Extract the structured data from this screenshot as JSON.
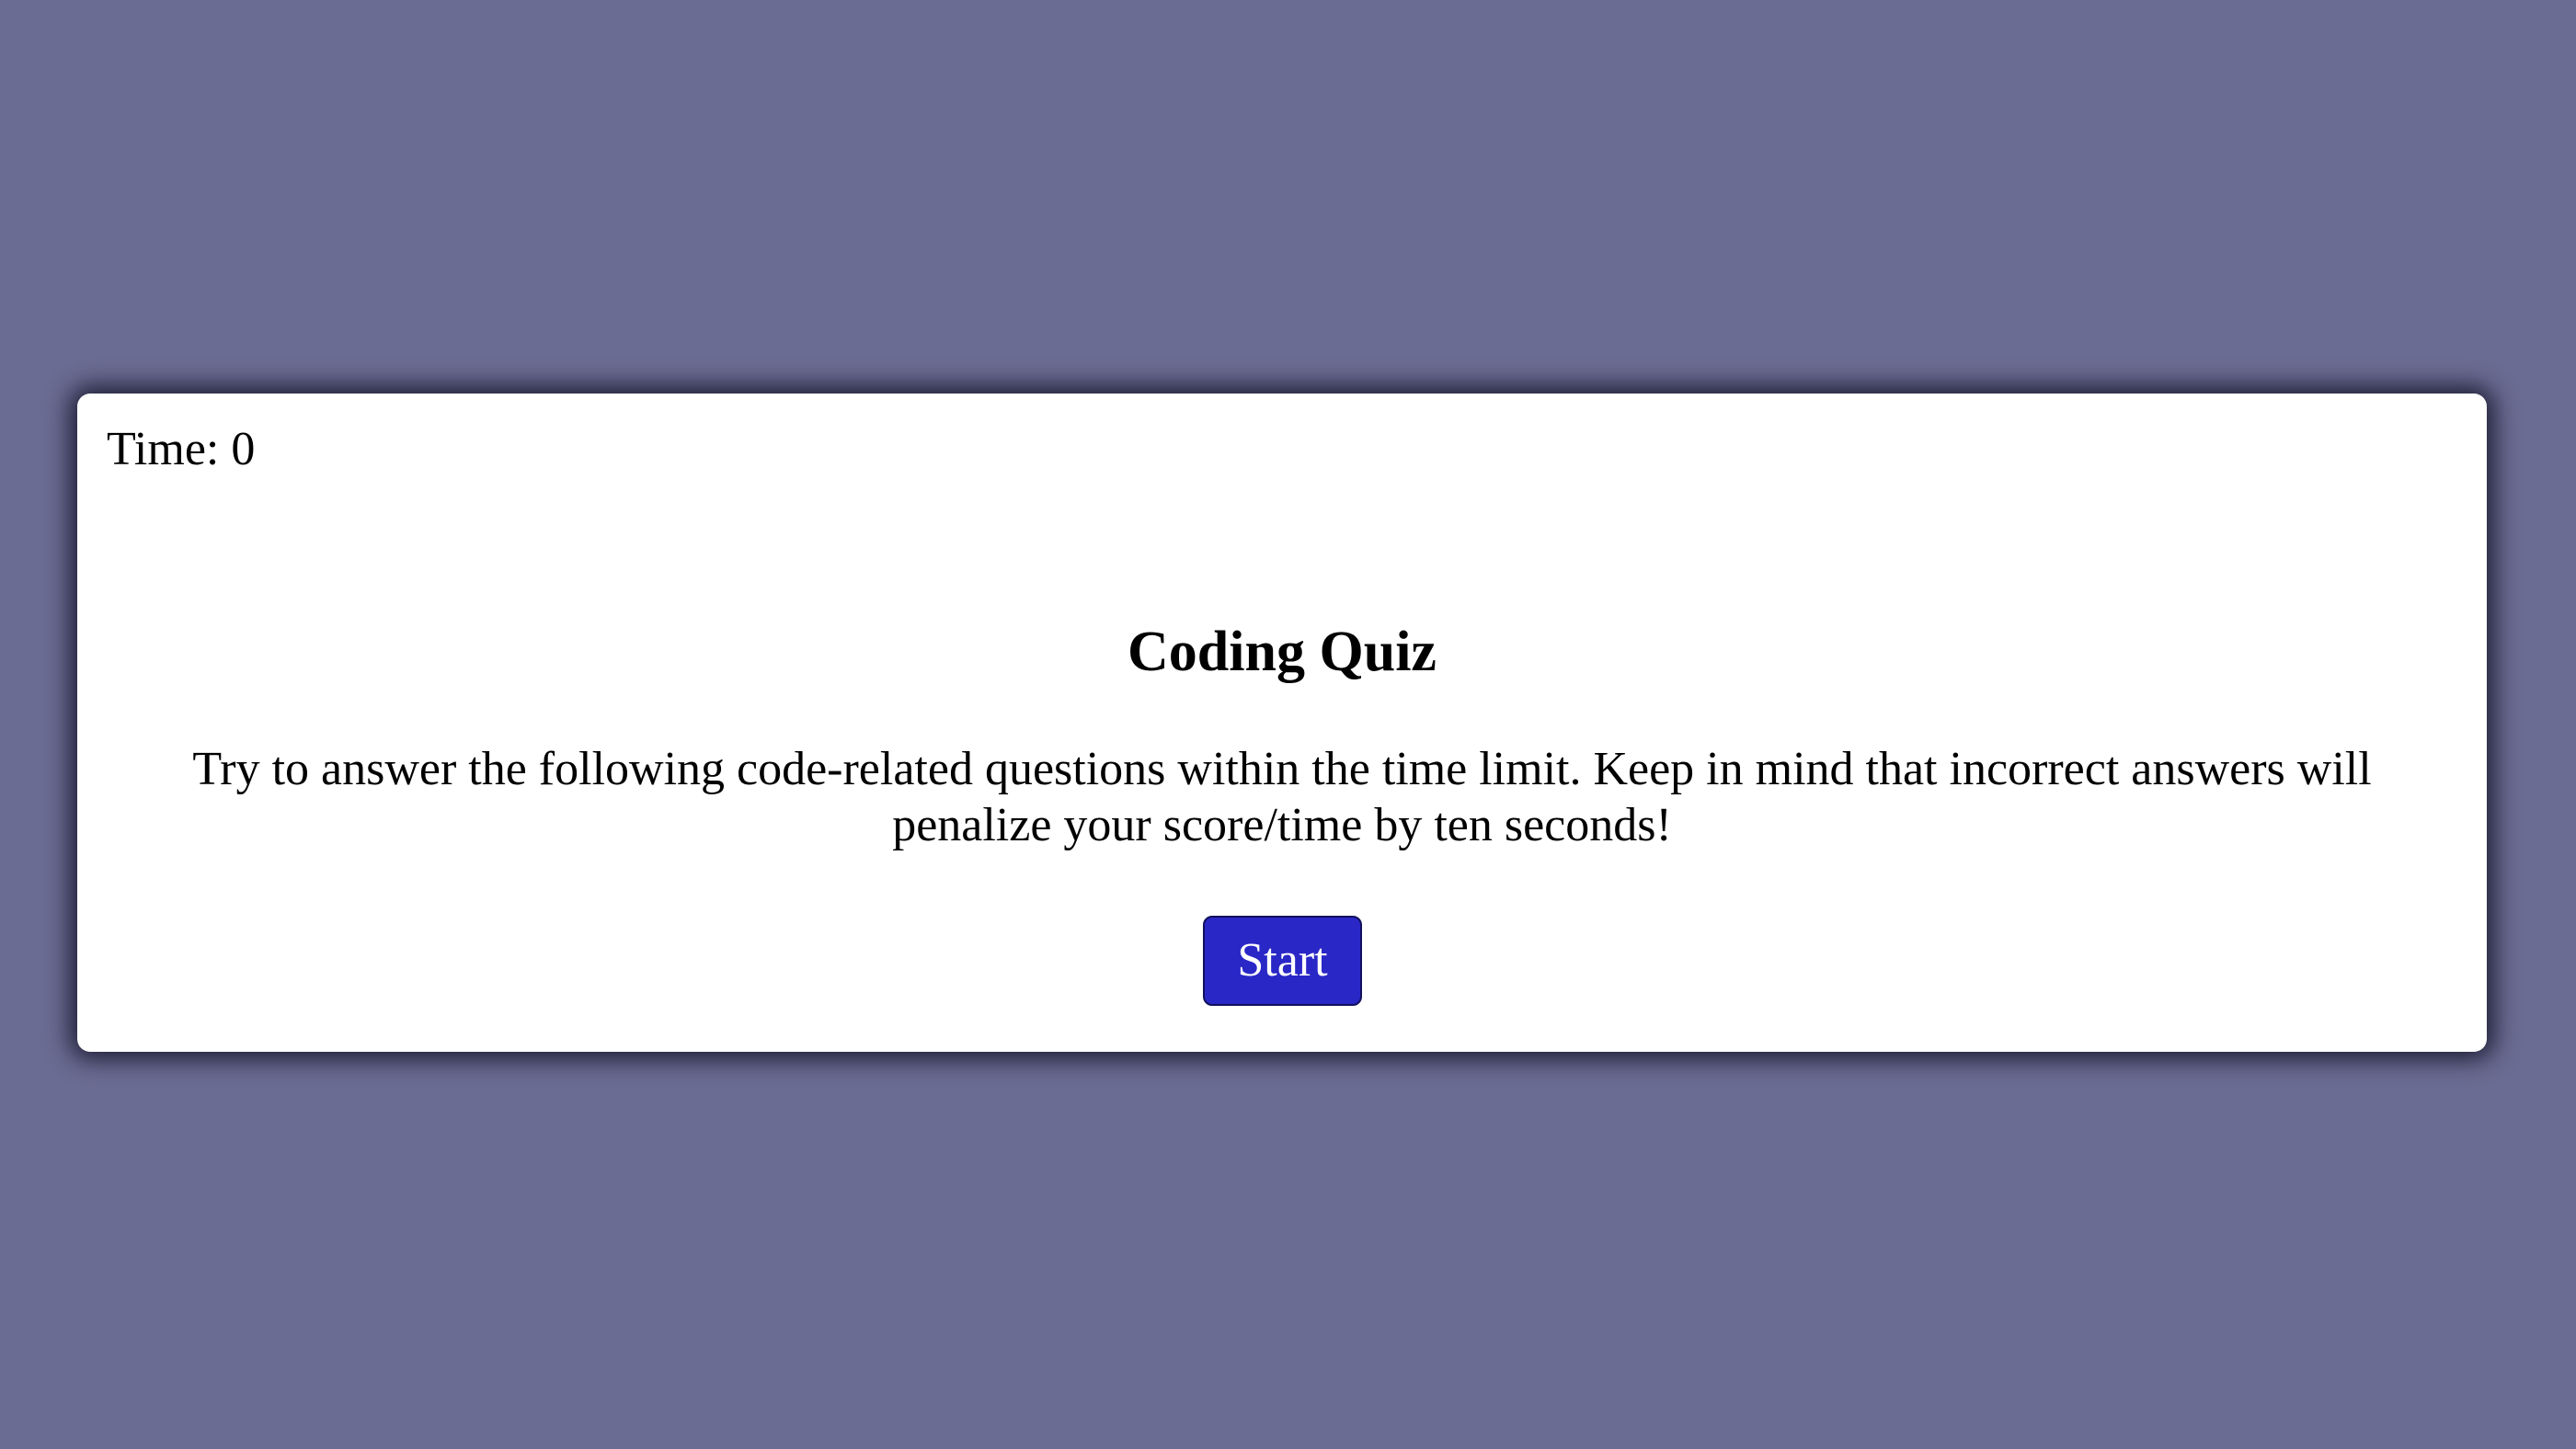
{
  "timer": {
    "label": "Time: 0"
  },
  "quiz": {
    "title": "Coding Quiz",
    "description": "Try to answer the following code-related questions within the time limit. Keep in mind that incorrect answers will penalize your score/time by ten seconds!",
    "start_label": "Start"
  },
  "colors": {
    "background": "#6b6c93",
    "card": "#ffffff",
    "button": "#2a27c7",
    "button_text": "#ffffff"
  }
}
